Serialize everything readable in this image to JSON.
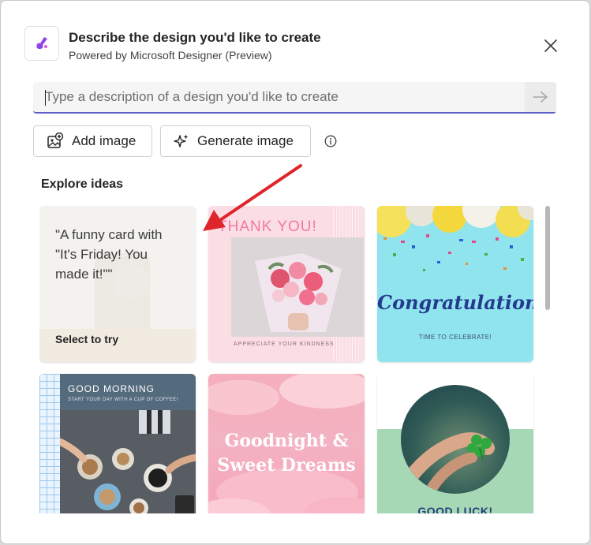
{
  "header": {
    "title": "Describe the design you'd like to create",
    "subtitle": "Powered by Microsoft Designer (Preview)"
  },
  "prompt": {
    "placeholder": "Type a description of a design you'd like to create"
  },
  "actions": {
    "add_image": "Add image",
    "generate_image": "Generate image"
  },
  "explore": {
    "title": "Explore ideas",
    "cards": [
      {
        "prompt": "\"A funny card with \"It's Friday! You made it!\"\"",
        "cta": "Select to try"
      },
      {
        "title": "THANK YOU!",
        "footer": "APPRECIATE YOUR KINDNESS"
      },
      {
        "title": "Congratulations!",
        "footer": "TIME TO CELEBRATE!"
      },
      {
        "title": "GOOD MORNING",
        "footer": "START YOUR DAY WITH A CUP OF COFFEE!"
      },
      {
        "title": "Goodnight & Sweet Dreams"
      },
      {
        "title": "GOOD LUCK!"
      }
    ]
  },
  "colors": {
    "accent": "#5b5fc7",
    "annotation_arrow": "#e0242b"
  }
}
